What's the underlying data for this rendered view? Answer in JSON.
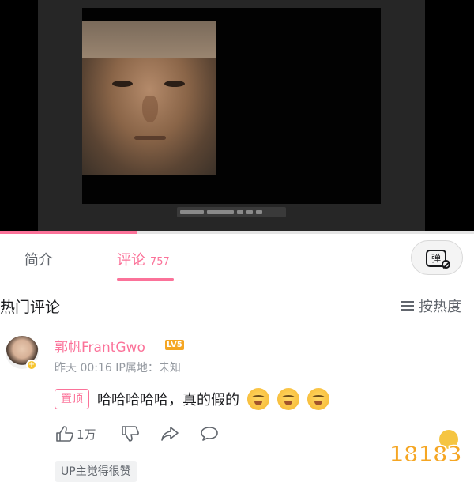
{
  "tabs": {
    "intro": "简介",
    "comments": "评论",
    "comments_count": "757"
  },
  "danmaku_button": {
    "glyph": "弹",
    "icon": "danmaku-off-icon"
  },
  "section": {
    "title": "热门评论",
    "sort_label": "按热度"
  },
  "comment": {
    "username": "郭帆FrantGwo",
    "level": "LV5",
    "meta": "昨天 00:16  IP属地：未知",
    "pin_label": "置顶",
    "text": "哈哈哈哈哈，真的假的",
    "emojis": [
      "laugh-cry-emoji",
      "laugh-cry-emoji",
      "laugh-cry-emoji"
    ],
    "likes": "1万",
    "up_liked": "UP主觉得很赞"
  },
  "watermark": {
    "text": "18183"
  },
  "colors": {
    "accent": "#fb7299",
    "text": "#18191c",
    "muted": "#9499a0"
  },
  "progress": 0.29
}
